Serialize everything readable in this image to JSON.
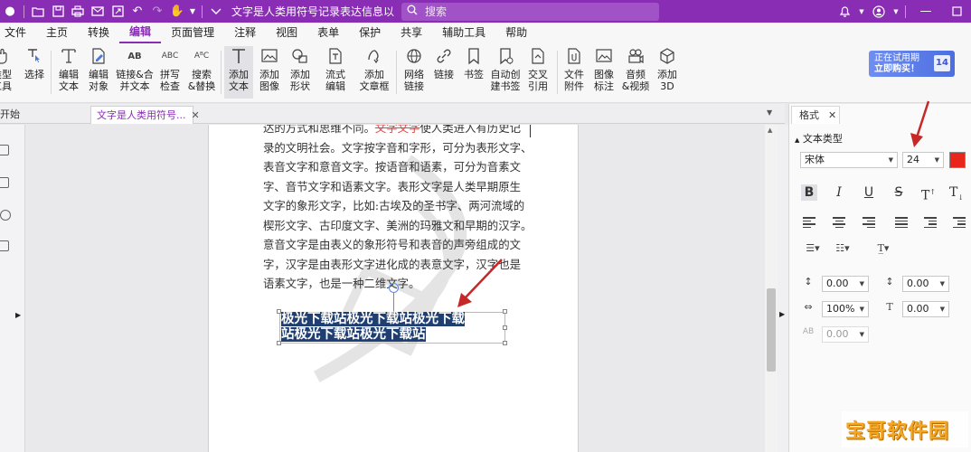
{
  "titlebar": {
    "doc_title": "文字是人类用符号记录表达信息以传之...",
    "search_placeholder": "搜索"
  },
  "menu": [
    "文件",
    "主页",
    "转换",
    "编辑",
    "页面管理",
    "注释",
    "视图",
    "表单",
    "保护",
    "共享",
    "辅助工具",
    "帮助"
  ],
  "active_menu": "编辑",
  "ribbon": {
    "buttons": [
      {
        "label1": "类型",
        "label2": "工具"
      },
      {
        "label1": "选择",
        "label2": ""
      },
      {
        "label1": "编辑",
        "label2": "文本"
      },
      {
        "label1": "编辑",
        "label2": "对象"
      },
      {
        "label1": "链接&合",
        "label2": "并文本"
      },
      {
        "label1": "拼写",
        "label2": "检查"
      },
      {
        "label1": "搜索",
        "label2": "&替换"
      },
      {
        "label1": "添加",
        "label2": "文本"
      },
      {
        "label1": "添加",
        "label2": "图像"
      },
      {
        "label1": "添加",
        "label2": "形状"
      },
      {
        "label1": "流式",
        "label2": "编辑"
      },
      {
        "label1": "添加",
        "label2": "文章框"
      },
      {
        "label1": "网络",
        "label2": "链接"
      },
      {
        "label1": "链接",
        "label2": ""
      },
      {
        "label1": "书签",
        "label2": ""
      },
      {
        "label1": "自动创",
        "label2": "建书签"
      },
      {
        "label1": "交叉",
        "label2": "引用"
      },
      {
        "label1": "文件",
        "label2": "附件"
      },
      {
        "label1": "图像",
        "label2": "标注"
      },
      {
        "label1": "音频",
        "label2": "&视频"
      },
      {
        "label1": "添加",
        "label2": "3D"
      }
    ],
    "trial_line1": "正在试用期",
    "trial_line2": "立即购买！",
    "trial_days": "14"
  },
  "tabs": {
    "start": "开始",
    "doc": "文字是人类用符号..."
  },
  "document": {
    "lines": [
      "达的方式和思维不同。",
      "录的文明社会。文字按字音和字形，可分为表形文字、",
      "表音文字和意音文字。按语音和语素，可分为音素文",
      "字、音节文字和语素文字。表形文字是人类早期原生",
      "文字的象形文字，比如:古埃及的圣书字、两河流域的",
      "楔形文字、古印度文字、美洲的玛雅文和早期的汉字。",
      "意音文字是由表义的象形符号和表音的声旁组成的文",
      "字，汉字是由表形文字进化成的表意文字，汉字也是",
      "语素文字，也是一种二维文字。"
    ],
    "strike_text": "文字文字",
    "line1_tail": "使人类进入有历史记",
    "selected_line1": "极光下载站极光下载站极光下载",
    "selected_line2": "站极光下载站极光下载站"
  },
  "format_panel": {
    "tab": "格式",
    "section": "文本类型",
    "font": "宋体",
    "size": "24",
    "color": "#e8261c",
    "spacing": [
      {
        "value": "0.00"
      },
      {
        "value": "0.00"
      },
      {
        "value": "100%"
      },
      {
        "value": "0.00"
      },
      {
        "value": "0.00"
      }
    ]
  },
  "watermark_badge": "宝哥软件园"
}
